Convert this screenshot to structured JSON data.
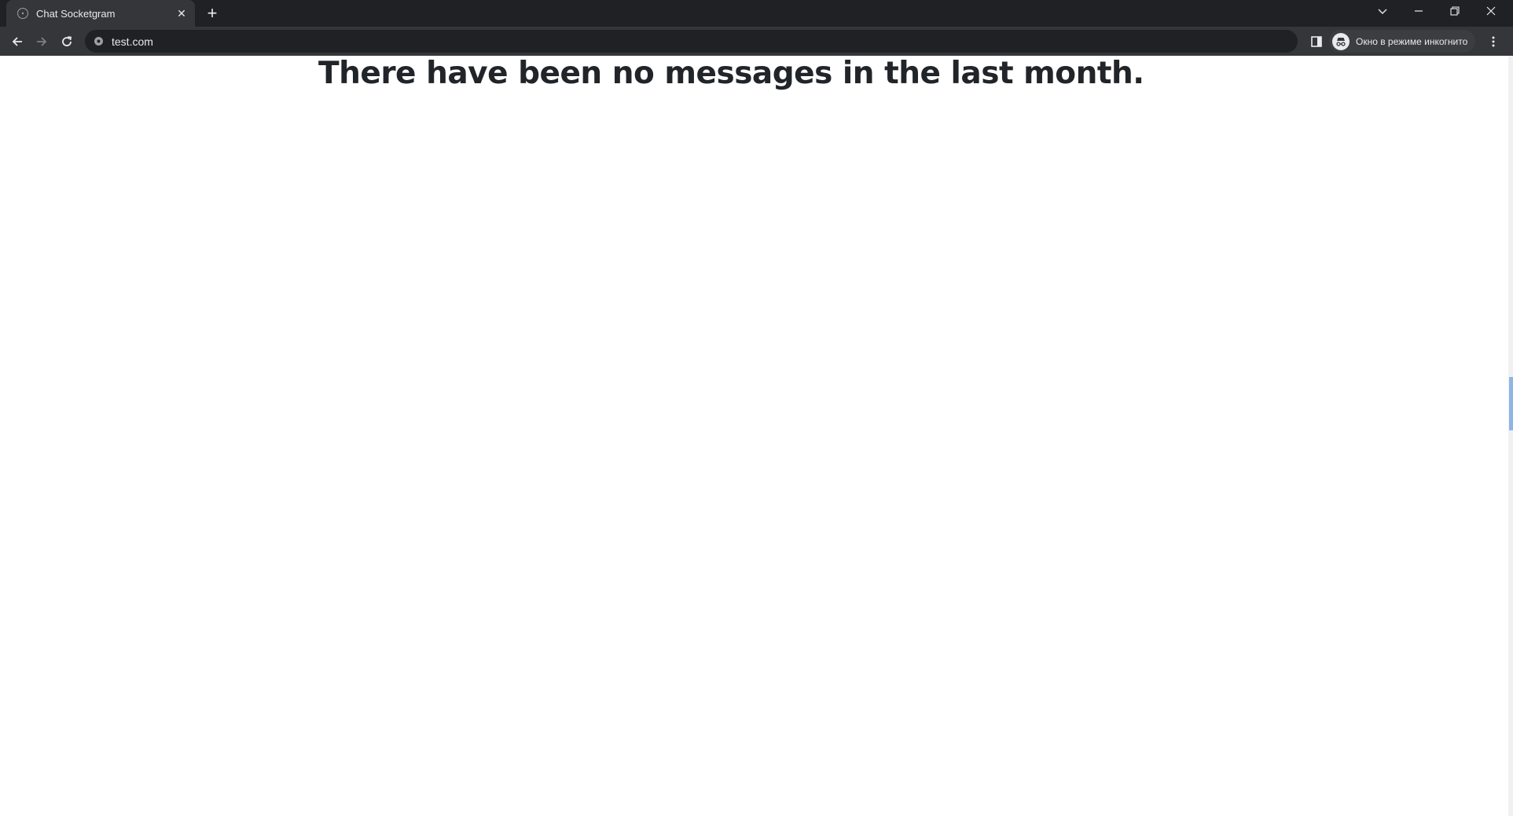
{
  "browser": {
    "tab": {
      "title": "Chat Socketgram",
      "close_glyph": "✕"
    },
    "new_tab_glyph": "+",
    "address_bar": {
      "url": "test.com"
    },
    "incognito": {
      "label": "Окно в режиме инкогнито"
    }
  },
  "page": {
    "heading": "There have been no messages in the last month."
  },
  "colors": {
    "tabstrip_bg": "#202124",
    "toolbar_bg": "#35363a",
    "heading_text": "#212529",
    "scroll_thumb": "#8fb5e6"
  },
  "icons": {
    "tab_favicon": "globe-icon",
    "back": "arrow-left-icon",
    "forward": "arrow-right-icon",
    "reload": "reload-icon",
    "site_info": "site-info-icon",
    "side_panel": "side-panel-icon",
    "incognito": "incognito-icon",
    "menu": "kebab-menu-icon",
    "tab_search": "chevron-down-icon",
    "minimize": "minimize-icon",
    "restore": "restore-icon",
    "close_window": "close-icon"
  }
}
